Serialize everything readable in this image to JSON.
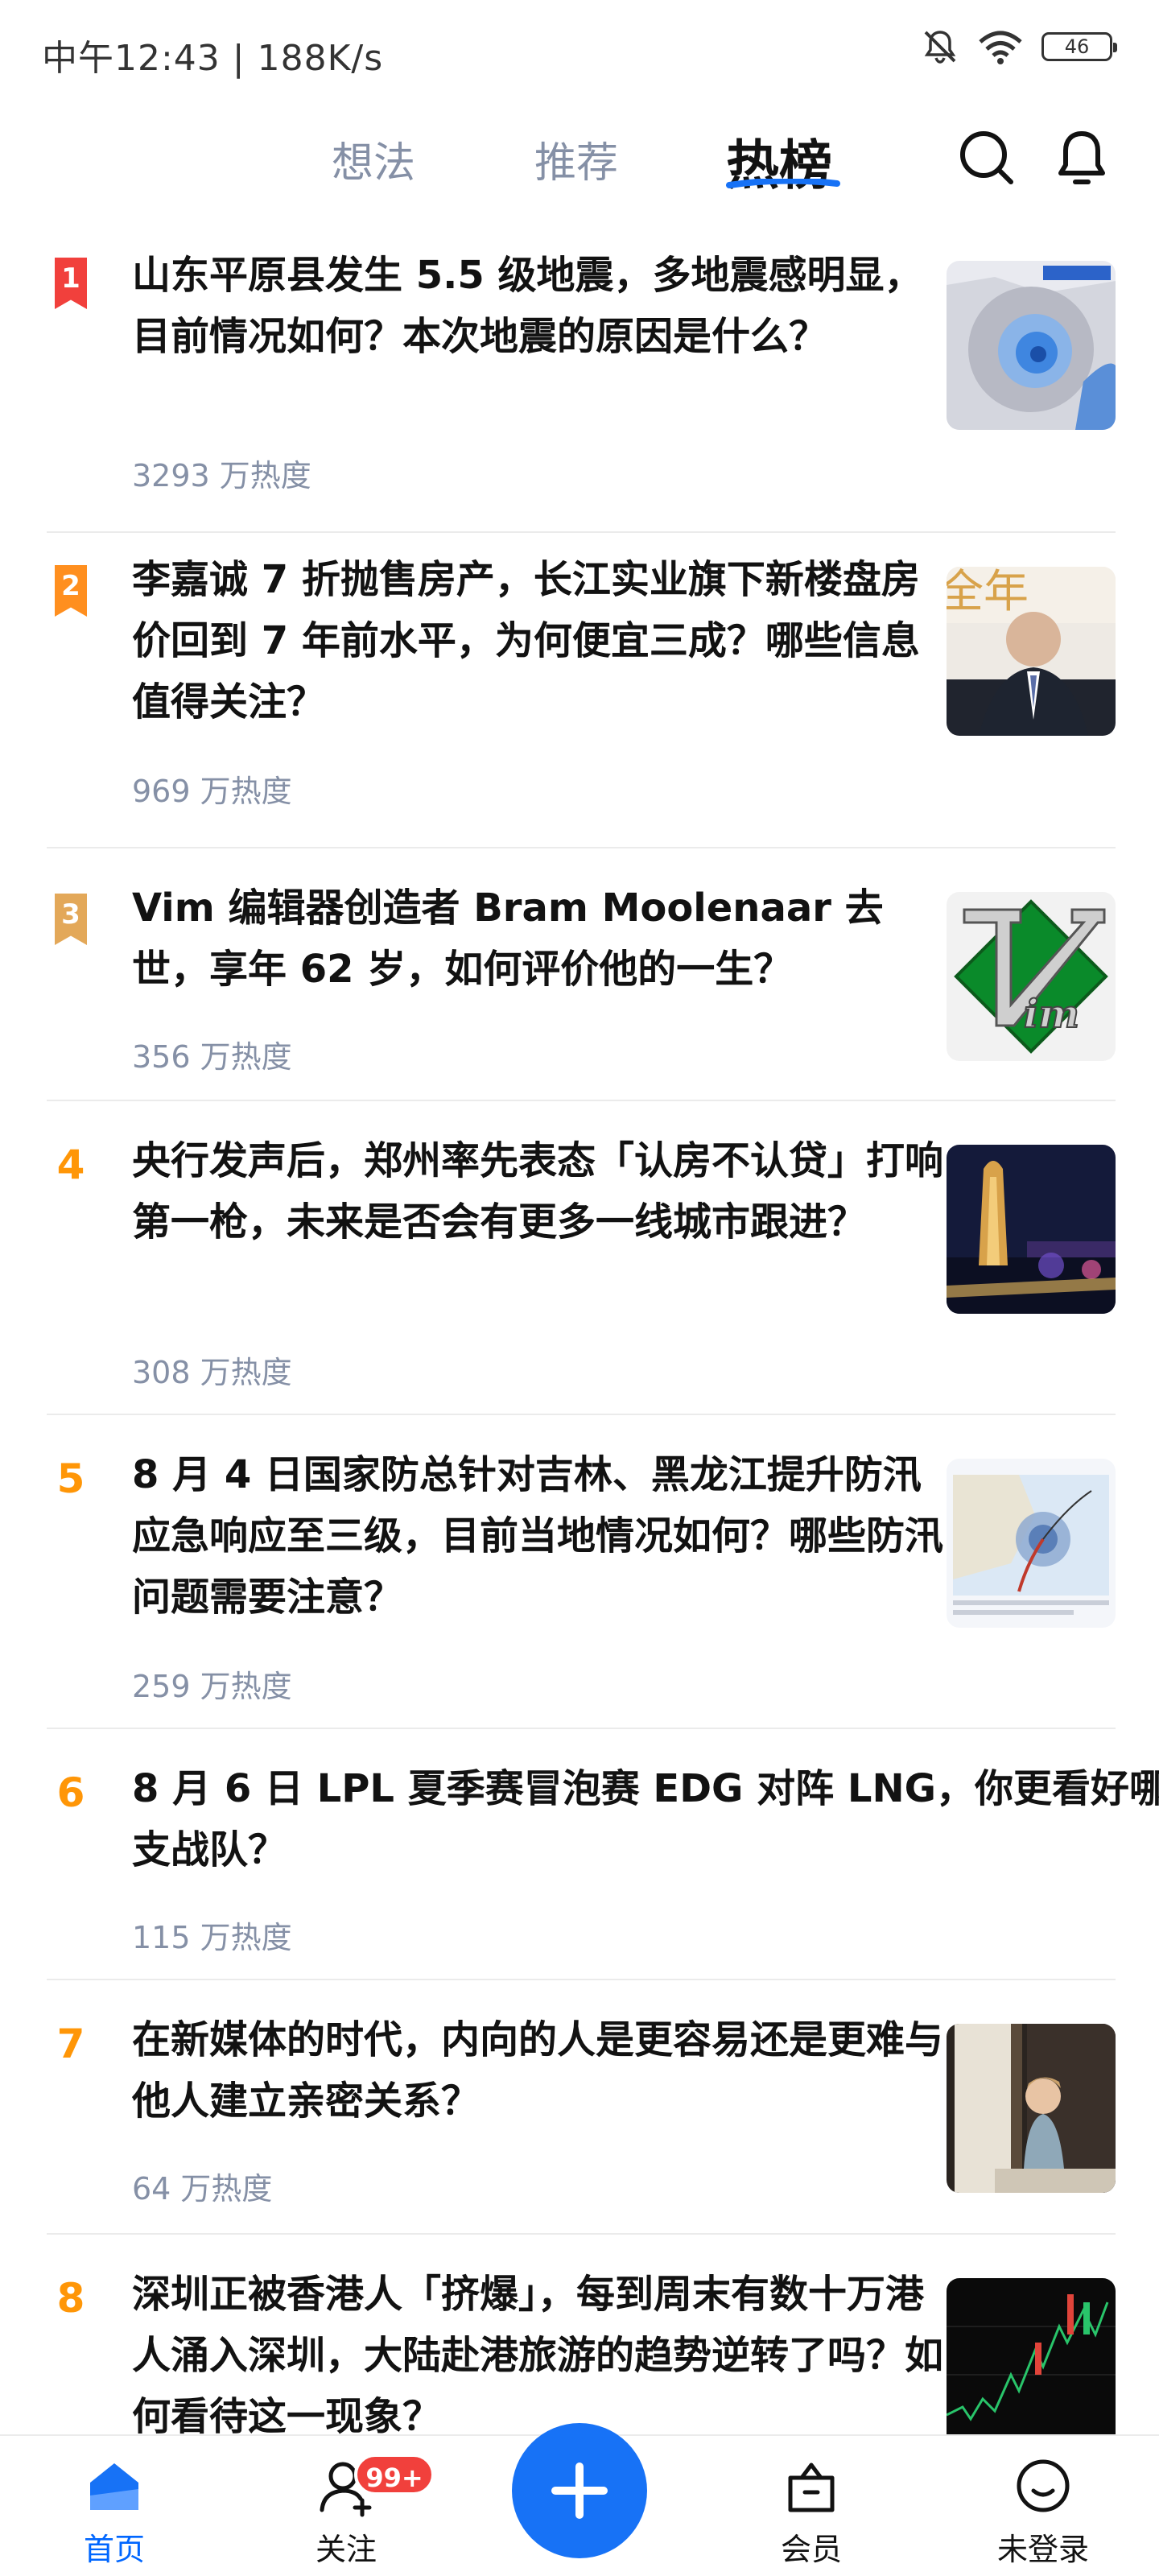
{
  "status_bar": {
    "time": "中午12:43 | 188K/s",
    "battery": "46"
  },
  "top_nav": {
    "tabs": [
      {
        "label": "想法"
      },
      {
        "label": "推荐"
      },
      {
        "label": "热榜"
      }
    ],
    "active_tab": "热榜",
    "icons": [
      "search-icon",
      "bell-icon"
    ]
  },
  "colors": {
    "accent": "#1772f6",
    "rank_1": "#f1403c",
    "rank_2": "#ff8f1f",
    "rank_3": "#e3a859",
    "rank_other": "#ff9607",
    "meta": "#8590a6"
  },
  "hot_list": [
    {
      "rank": "1",
      "title": "山东平原县发生 5.5 级地震，多地震感明显，目前情况如何？本次地震的原因是什么？",
      "heat": "3293 万热度",
      "thumb": "earthquake-map"
    },
    {
      "rank": "2",
      "title": "李嘉诚 7 折抛售房产，长江实业旗下新楼盘房价回到 7 年前水平，为何便宜三成？哪些信息值得关注？",
      "heat": "969 万热度",
      "thumb": "person-photo"
    },
    {
      "rank": "3",
      "title": "Vim 编辑器创造者 Bram Moolenaar 去世，享年 62 岁，如何评价他的一生？",
      "heat": "356 万热度",
      "thumb": "vim-logo"
    },
    {
      "rank": "4",
      "title": "央行发声后，郑州率先表态「认房不认贷」打响第一枪，未来是否会有更多一线城市跟进？",
      "heat": "308 万热度",
      "thumb": "city-night"
    },
    {
      "rank": "5",
      "title": "8 月 4 日国家防总针对吉林、黑龙江提升防汛应急响应至三级，目前当地情况如何？哪些防汛问题需要注意？",
      "heat": "259 万热度",
      "thumb": "typhoon-map"
    },
    {
      "rank": "6",
      "title": "8 月 6 日 LPL 夏季赛冒泡赛 EDG 对阵 LNG，你更看好哪支战队？",
      "heat": "115 万热度",
      "thumb": ""
    },
    {
      "rank": "7",
      "title": "在新媒体的时代，内向的人是更容易还是更难与他人建立亲密关系？",
      "heat": "64 万热度",
      "thumb": "child-window"
    },
    {
      "rank": "8",
      "title": "深圳正被香港人「挤爆」，每到周末有数十万港人涌入深圳，大陆赴港旅游的趋势逆转了吗？如何看待这一现象？",
      "heat": "",
      "thumb": "stock-chart"
    }
  ],
  "bottom_nav": {
    "items": [
      {
        "label": "首页",
        "icon": "home-icon"
      },
      {
        "label": "关注",
        "icon": "follow-icon",
        "badge": "99+"
      },
      {
        "label": "",
        "icon": "plus-icon"
      },
      {
        "label": "会员",
        "icon": "member-icon"
      },
      {
        "label": "未登录",
        "icon": "profile-icon"
      }
    ]
  }
}
